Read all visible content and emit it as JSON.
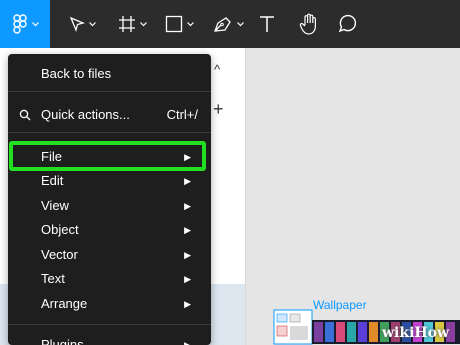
{
  "toolbar": {
    "tools": [
      "figma-menu-icon",
      "move-tool-icon",
      "frame-tool-icon",
      "shape-tool-icon",
      "pen-tool-icon",
      "text-tool-icon",
      "hand-tool-icon",
      "comment-tool-icon"
    ],
    "accent": "#0d99ff",
    "background": "#2c2c2c"
  },
  "panel": {
    "header_fragment": "s ^",
    "add_label": "+"
  },
  "menu": {
    "back": "Back to files",
    "quick_actions": "Quick actions...",
    "quick_actions_shortcut": "Ctrl+/",
    "items": [
      {
        "label": "File"
      },
      {
        "label": "Edit"
      },
      {
        "label": "View"
      },
      {
        "label": "Object"
      },
      {
        "label": "Vector"
      },
      {
        "label": "Text"
      },
      {
        "label": "Arrange"
      },
      {
        "label": "Plugins"
      }
    ],
    "arrow": "▶"
  },
  "canvas": {
    "frame_label": "Wallpaper"
  },
  "watermark": "wikiHow",
  "colors": {
    "highlight": "#20e020",
    "menu_bg": "#1e1e1e"
  }
}
